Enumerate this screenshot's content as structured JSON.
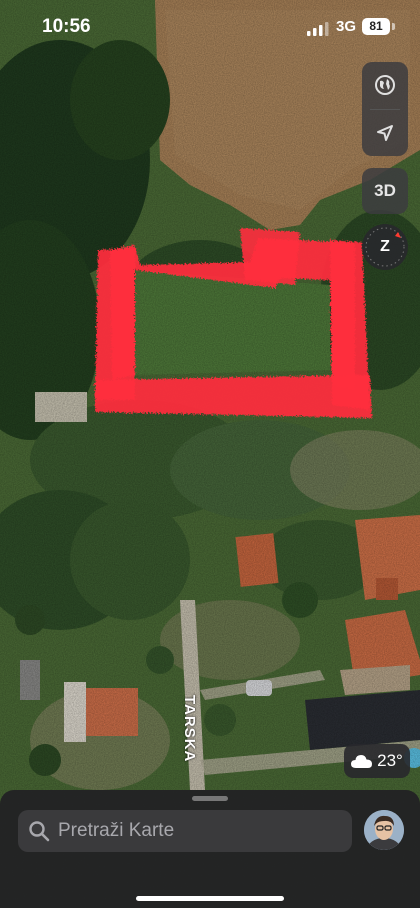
{
  "status_bar": {
    "time": "10:56",
    "network": "3G",
    "battery": "81"
  },
  "map": {
    "street_label": "TARSKA",
    "marked_area_color": "#ff2d3d"
  },
  "controls": {
    "globe_icon": "globe-icon",
    "location_icon": "location-arrow-icon",
    "view_3d_label": "3D",
    "compass_label": "Z"
  },
  "weather": {
    "temperature": "23°",
    "icon": "cloud-icon"
  },
  "search": {
    "placeholder": "Pretraži Karte"
  }
}
